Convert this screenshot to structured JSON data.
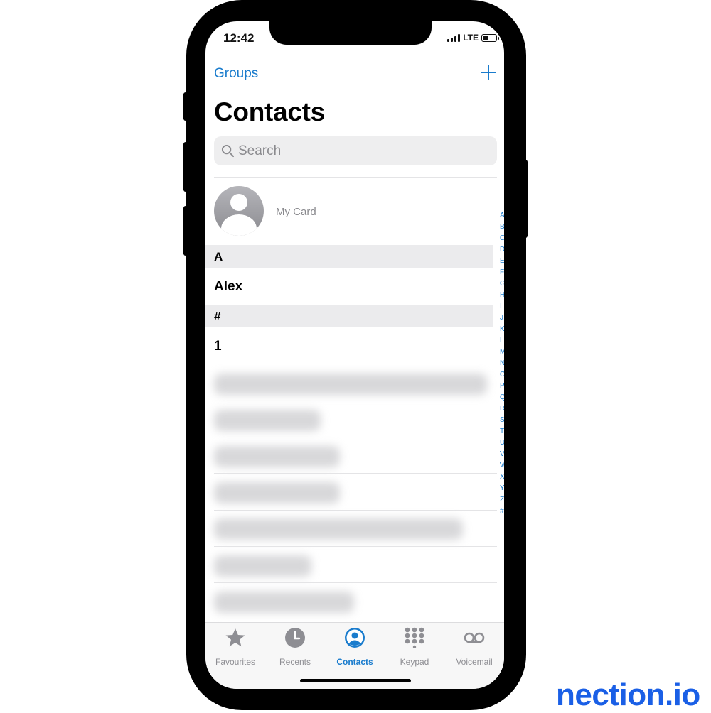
{
  "status_bar": {
    "time": "12:42",
    "network": "LTE"
  },
  "nav": {
    "groups_label": "Groups"
  },
  "page_title": "Contacts",
  "search": {
    "placeholder": "Search"
  },
  "my_card": {
    "label": "My Card"
  },
  "sections": [
    {
      "letter": "A",
      "contacts": [
        "Alex"
      ]
    },
    {
      "letter": "#",
      "contacts": [
        "1"
      ]
    }
  ],
  "index_letters": [
    "A",
    "B",
    "C",
    "D",
    "E",
    "F",
    "G",
    "H",
    "I",
    "J",
    "K",
    "L",
    "M",
    "N",
    "O",
    "P",
    "Q",
    "R",
    "S",
    "T",
    "U",
    "V",
    "W",
    "X",
    "Y",
    "Z",
    "#"
  ],
  "tabs": [
    {
      "label": "Favourites",
      "icon": "star-icon"
    },
    {
      "label": "Recents",
      "icon": "clock-icon"
    },
    {
      "label": "Contacts",
      "icon": "person-circle-icon",
      "active": true
    },
    {
      "label": "Keypad",
      "icon": "keypad-icon"
    },
    {
      "label": "Voicemail",
      "icon": "voicemail-icon"
    }
  ],
  "watermark": "nection.io",
  "colors": {
    "accent": "#1a7ccd",
    "brand": "#1a5fe6"
  }
}
